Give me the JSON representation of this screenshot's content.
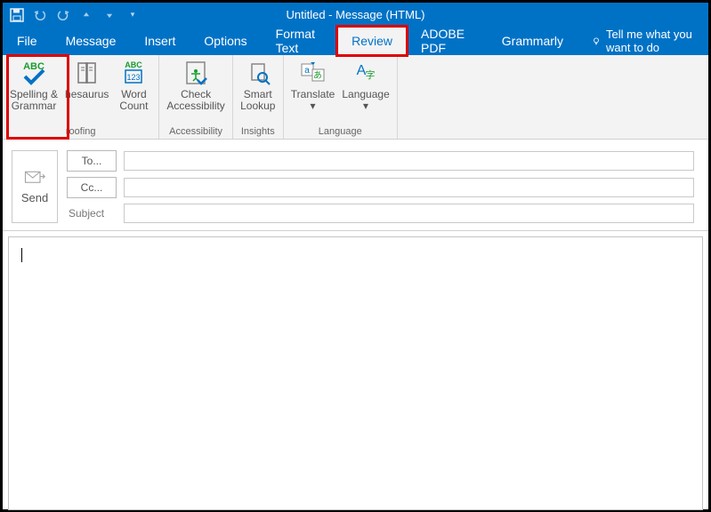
{
  "titlebar": {
    "title": "Untitled  -  Message (HTML)"
  },
  "tabs": {
    "file": "File",
    "message": "Message",
    "insert": "Insert",
    "options": "Options",
    "format_text": "Format Text",
    "review": "Review",
    "adobe_pdf": "ADOBE PDF",
    "grammarly": "Grammarly",
    "search": "Tell me what you want to do"
  },
  "ribbon": {
    "spelling_grammar": "Spelling &\nGrammar",
    "thesaurus": "hesaurus",
    "word_count": "Word\nCount",
    "proofing_group": "roofing",
    "check_accessibility": "Check\nAccessibility",
    "accessibility_group": "Accessibility",
    "smart_lookup": "Smart\nLookup",
    "insights_group": "Insights",
    "translate": "Translate",
    "language": "Language",
    "language_group": "Language"
  },
  "compose": {
    "send": "Send",
    "to": "To...",
    "cc": "Cc...",
    "subject_label": "Subject",
    "to_value": "",
    "cc_value": "",
    "subject_value": ""
  },
  "body": ""
}
